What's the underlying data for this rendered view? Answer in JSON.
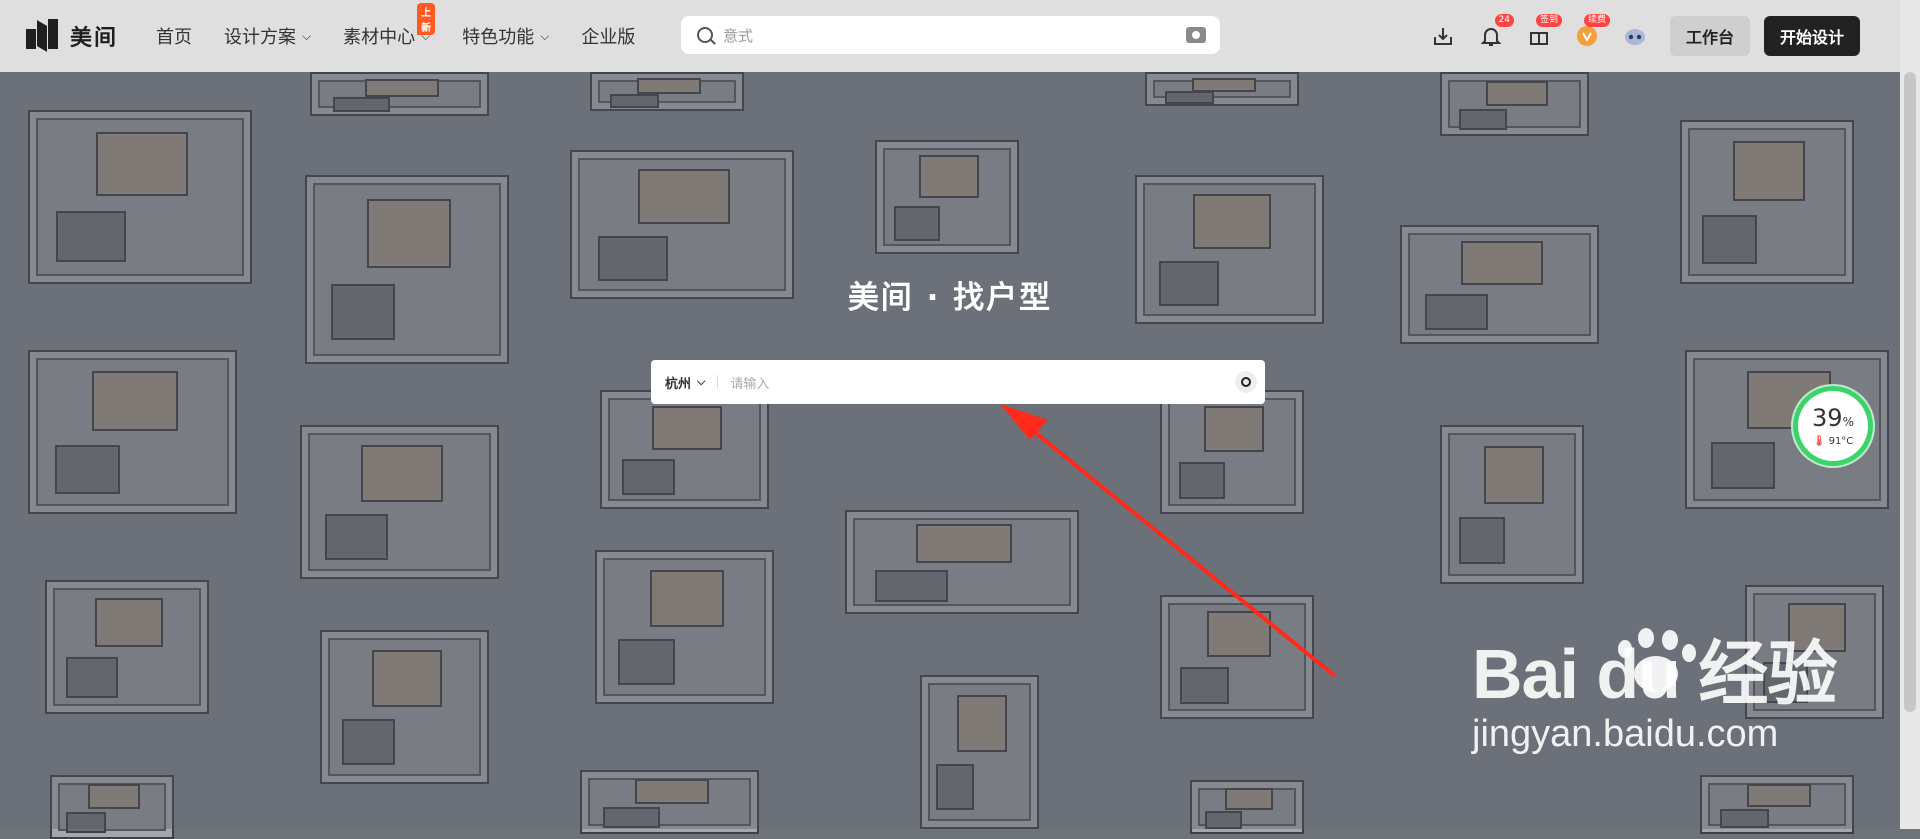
{
  "topbar": {
    "brand": "美间",
    "nav": [
      {
        "label": "首页",
        "has_dropdown": false
      },
      {
        "label": "设计方案",
        "has_dropdown": true
      },
      {
        "label": "素材中心",
        "has_dropdown": true,
        "tag": "上新"
      },
      {
        "label": "特色功能",
        "has_dropdown": true
      },
      {
        "label": "企业版",
        "has_dropdown": false
      }
    ],
    "search_placeholder": "意式",
    "icons": [
      {
        "name": "download-icon",
        "badge": ""
      },
      {
        "name": "bell-icon",
        "badge": "24"
      },
      {
        "name": "gift-icon",
        "badge": "签到"
      },
      {
        "name": "vip-icon",
        "badge": "续费"
      },
      {
        "name": "robot-icon",
        "badge": ""
      }
    ],
    "workbench_label": "工作台",
    "start_label": "开始设计"
  },
  "hero": {
    "title": "美间 · 找户型",
    "city": "杭州",
    "search_placeholder": "请输入"
  },
  "gauge": {
    "percent": "39",
    "percent_unit": "%",
    "temperature": "91°C",
    "accent": "#3cd36b"
  },
  "watermark": {
    "brand": "Bai du 经验",
    "url": "jingyan.baidu.com"
  },
  "colors": {
    "arrow": "#ff2a1a",
    "start_button": "#222222"
  }
}
